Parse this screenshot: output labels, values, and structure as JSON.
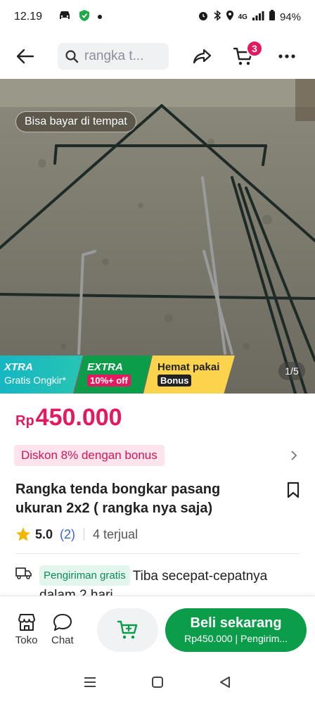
{
  "status_bar": {
    "time": "12.19",
    "network": "4G",
    "battery": "94%"
  },
  "header": {
    "search_placeholder": "rangka t...",
    "cart_count": "3"
  },
  "gallery": {
    "cod_label": "Bisa bayar di tempat",
    "page_indicator": "1/5",
    "promos": {
      "xtra_title": "XTRA",
      "xtra_sub": "Gratis Ongkir*",
      "extra_title": "EXTRA",
      "extra_sub": "10%+ off",
      "hemat_title": "Hemat pakai",
      "hemat_sub": "Bonus"
    }
  },
  "product": {
    "price_currency": "Rp",
    "price_amount": "450.000",
    "discount_label": "Diskon 8% dengan bonus",
    "title": "Rangka tenda bongkar pasang ukuran 2x2 ( rangka nya saja)",
    "rating": "5.0",
    "review_count": "(2)",
    "sold": "4 terjual"
  },
  "shipping": {
    "badge": "Pengiriman gratis",
    "text": "Tiba secepat-cepatnya dalam 2 hari"
  },
  "actions": {
    "store_label": "Toko",
    "chat_label": "Chat",
    "buy_label": "Beli sekarang",
    "buy_sub": "Rp450.000 | Pengirim..."
  },
  "colors": {
    "brand_pink": "#e5195f",
    "brand_green": "#0b9d4a",
    "rating_star": "#f5b400"
  }
}
